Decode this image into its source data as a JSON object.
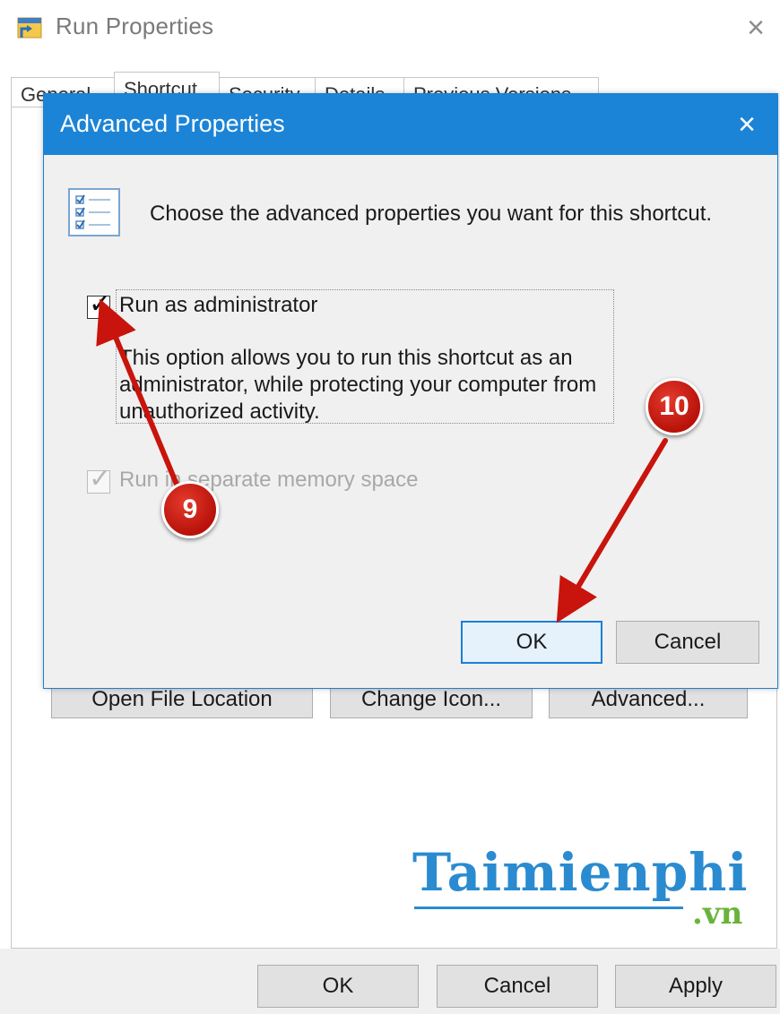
{
  "outer_window": {
    "title": "Run Properties",
    "close_glyph": "×",
    "tabs": [
      {
        "label": "General",
        "active": false
      },
      {
        "label": "Shortcut",
        "active": true
      },
      {
        "label": "Security",
        "active": false
      },
      {
        "label": "Details",
        "active": false
      },
      {
        "label": "Previous Versions",
        "active": false
      }
    ],
    "panel_buttons": {
      "open_file_location": "Open File Location",
      "change_icon": "Change Icon...",
      "advanced": "Advanced..."
    },
    "footer_buttons": {
      "ok": "OK",
      "cancel": "Cancel",
      "apply": "Apply"
    }
  },
  "dialog": {
    "title": "Advanced Properties",
    "close_glyph": "×",
    "intro": "Choose the advanced properties you want for this shortcut.",
    "run_as_admin": {
      "label": "Run as administrator",
      "checked": true,
      "description": "This option allows you to run this shortcut as an administrator, while protecting your computer from unauthorized activity."
    },
    "separate_memory": {
      "label": "Run in separate memory space",
      "checked": true,
      "enabled": false
    },
    "buttons": {
      "ok": "OK",
      "cancel": "Cancel"
    }
  },
  "annotations": {
    "step_9": "9",
    "step_10": "10",
    "color": "#c8140c"
  },
  "watermark": {
    "brand": "Taimienphi",
    "suffix": ".vn"
  },
  "icons": {
    "app": "run-shortcut-icon",
    "properties": "checklist-icon",
    "check": "✓"
  },
  "colors": {
    "accent": "#1c84d6",
    "dialog_bg": "#f0f0f0",
    "button_bg": "#e1e1e1",
    "watermark_blue": "#2a8bd0",
    "watermark_green": "#6ab33b"
  }
}
